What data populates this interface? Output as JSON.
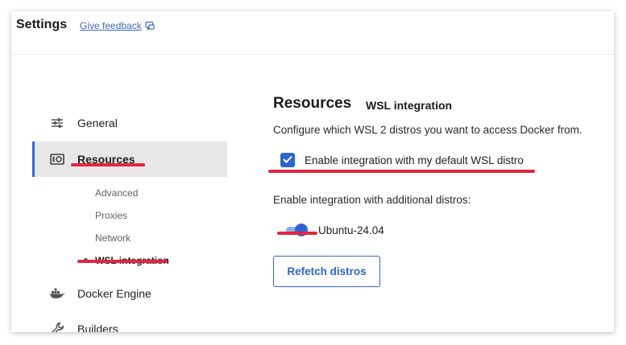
{
  "header": {
    "title": "Settings",
    "feedback_link": "Give feedback"
  },
  "sidebar": {
    "items": [
      {
        "label": "General",
        "icon": "sliders-icon"
      },
      {
        "label": "Resources",
        "icon": "resources-icon",
        "active": true
      },
      {
        "label": "Docker Engine",
        "icon": "whale-icon"
      },
      {
        "label": "Builders",
        "icon": "wrench-icon"
      }
    ],
    "subitems": [
      {
        "label": "Advanced"
      },
      {
        "label": "Proxies"
      },
      {
        "label": "Network"
      },
      {
        "label": "WSL integration",
        "active": true
      }
    ]
  },
  "main": {
    "heading": "Resources",
    "subheading": "WSL integration",
    "description": "Configure which WSL 2 distros you want to access Docker from.",
    "default_distro_label": "Enable integration with my default WSL distro",
    "default_distro_checked": true,
    "additional_label": "Enable integration with additional distros:",
    "distros": [
      {
        "name": "Ubuntu-24.04",
        "enabled": true
      }
    ],
    "refetch_button": "Refetch distros"
  },
  "colors": {
    "accent": "#2f64d3",
    "annotation": "#e3253f",
    "active_bg": "#e7e7e7"
  }
}
